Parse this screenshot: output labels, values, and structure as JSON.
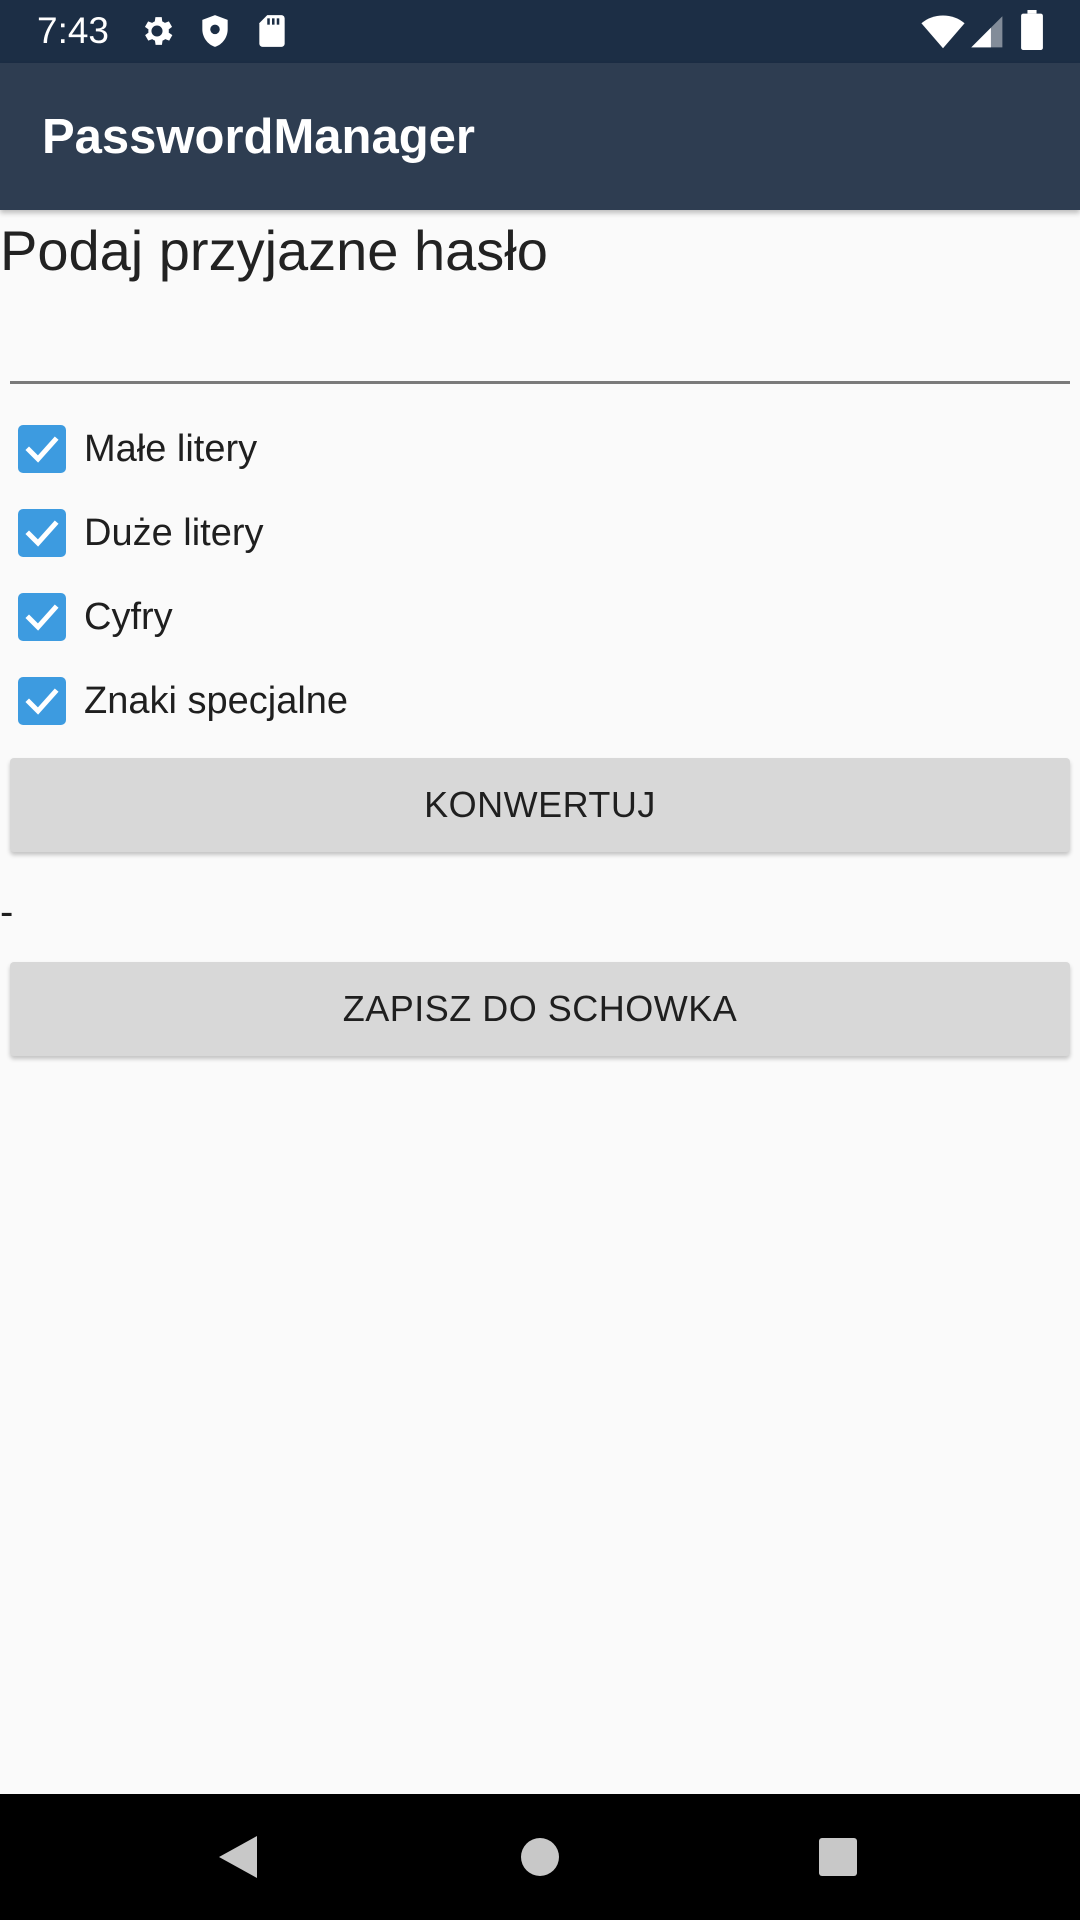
{
  "status_bar": {
    "time": "7:43",
    "icons": [
      "gear-icon",
      "shield-icon",
      "sd-card-icon",
      "wifi-icon",
      "signal-icon",
      "battery-icon"
    ]
  },
  "app_bar": {
    "title": "PasswordManager"
  },
  "form": {
    "prompt": "Podaj przyjazne hasło",
    "input_value": "",
    "options": [
      {
        "label": "Małe litery",
        "checked": true
      },
      {
        "label": "Duże litery",
        "checked": true
      },
      {
        "label": "Cyfry",
        "checked": true
      },
      {
        "label": "Znaki specjalne",
        "checked": true
      }
    ],
    "convert_button": "KONWERTUJ",
    "result": "-",
    "copy_button": "ZAPISZ DO SCHOWKA"
  },
  "nav_bar": {
    "icons": [
      "back-icon",
      "home-icon",
      "recents-icon"
    ]
  },
  "colors": {
    "status_bar": "#1c2e45",
    "app_bar": "#2e3d51",
    "checkbox": "#3d9be0",
    "button": "#d8d8d8",
    "background": "#fafafa"
  }
}
